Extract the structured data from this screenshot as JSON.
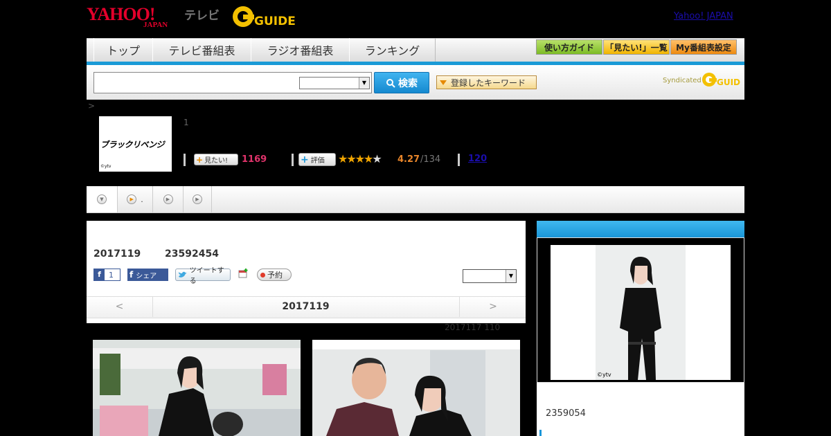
{
  "header": {
    "logo_yahoo": "YAHOO!",
    "logo_japan": "JAPAN",
    "logo_tv": "テレビ",
    "logo_gguide": "GUIDE",
    "yahoo_japan_link": "Yahoo! JAPAN"
  },
  "nav": {
    "tabs": [
      {
        "label": "トップ"
      },
      {
        "label": "テレビ番組表"
      },
      {
        "label": "ラジオ番組表"
      },
      {
        "label": "ランキング"
      }
    ],
    "buttons": [
      {
        "label": "使い方ガイド"
      },
      {
        "label": "「見たい!」一覧"
      },
      {
        "label": "My番組表設定"
      }
    ]
  },
  "search": {
    "button_label": "検索",
    "keyword_button": "登録したキーワード",
    "syndicated": "Syndicated"
  },
  "breadcrumb": {
    "arrow": ">"
  },
  "program": {
    "thumb_title": "ブラックリベンジ",
    "thumb_copyright": "©ytv",
    "episode": "1",
    "mitai_label": "見たい!",
    "mitai_count": "1169",
    "hyoka_label": "評価",
    "stars": "★★★★★",
    "rating": "4.27",
    "rating_count": "/134",
    "review_count": "120"
  },
  "subtabs": {
    "tab2_label": "."
  },
  "main": {
    "date": "2017119",
    "code": "23592454",
    "fb_like_count": "1",
    "fb_share": "シェア",
    "tweet": "ツイートする",
    "yoyaku": "予約",
    "prev": "<",
    "pager_date": "2017119",
    "next": ">",
    "note": "2017117  110"
  },
  "right": {
    "cast_copyright": "©ytv",
    "cast_code": "2359054"
  },
  "colors": {
    "accent_blue": "#1a9ad6",
    "yahoo_red": "#e4002b",
    "mitai_pink": "#e0336b",
    "rating_orange": "#e8852a"
  }
}
